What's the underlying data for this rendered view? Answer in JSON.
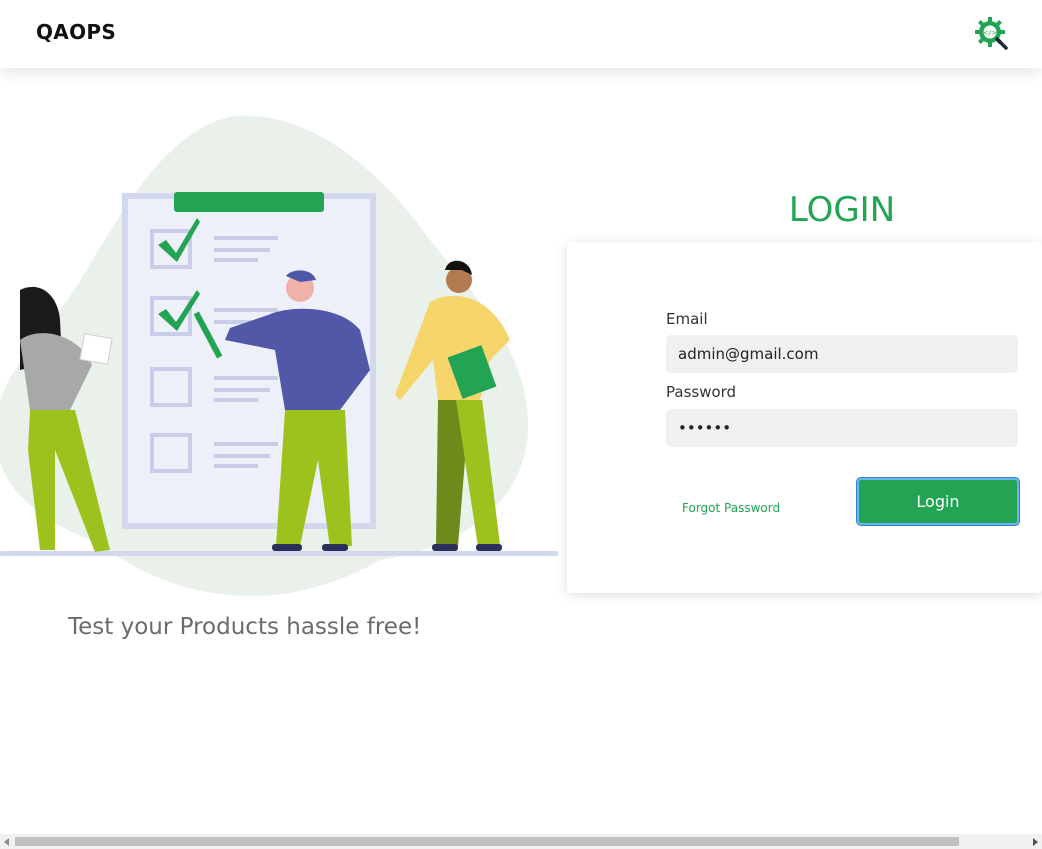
{
  "header": {
    "brand": "QAOPS",
    "logo_icon": "gear-code-search-icon"
  },
  "hero": {
    "tagline": "Test your Products hassle free!",
    "illustration": "checklist-team-illustration"
  },
  "login": {
    "title": "LOGIN",
    "email_label": "Email",
    "email_value": "admin@gmail.com",
    "password_label": "Password",
    "password_value": "••••••",
    "forgot_label": "Forgot Password",
    "submit_label": "Login"
  },
  "colors": {
    "accent": "#23a455",
    "input_bg": "#f1f0ee",
    "text_muted": "#6b6b6b",
    "blob": "#e9f1ea",
    "board": "#d4d8ee"
  }
}
